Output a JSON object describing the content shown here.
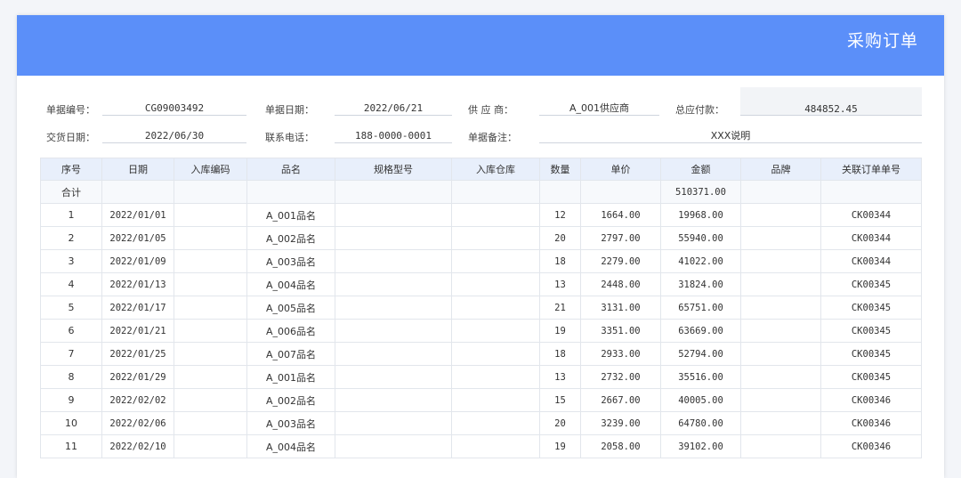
{
  "title": "采购订单",
  "info": {
    "order_no_label": "单据编号：",
    "order_no": "CG09003492",
    "order_date_label": "单据日期：",
    "order_date": "2022/06/21",
    "supplier_label": "供 应 商：",
    "supplier": "A_001供应商",
    "total_payable_label": "总应付款：",
    "total_payable": "484852.45",
    "delivery_date_label": "交货日期：",
    "delivery_date": "2022/06/30",
    "phone_label": "联系电话：",
    "phone": "188-0000-0001",
    "remark_label": "单据备注：",
    "remark": "XXX说明"
  },
  "table": {
    "headers": [
      "序号",
      "日期",
      "入库编码",
      "品名",
      "规格型号",
      "入库仓库",
      "数量",
      "单价",
      "金额",
      "品牌",
      "关联订单单号"
    ],
    "total_row": [
      "合计",
      "",
      "",
      "",
      "",
      "",
      "",
      "",
      "510371.00",
      "",
      ""
    ],
    "rows": [
      [
        "1",
        "2022/01/01",
        "",
        "A_001品名",
        "",
        "",
        "12",
        "1664.00",
        "19968.00",
        "",
        "CK00344"
      ],
      [
        "2",
        "2022/01/05",
        "",
        "A_002品名",
        "",
        "",
        "20",
        "2797.00",
        "55940.00",
        "",
        "CK00344"
      ],
      [
        "3",
        "2022/01/09",
        "",
        "A_003品名",
        "",
        "",
        "18",
        "2279.00",
        "41022.00",
        "",
        "CK00344"
      ],
      [
        "4",
        "2022/01/13",
        "",
        "A_004品名",
        "",
        "",
        "13",
        "2448.00",
        "31824.00",
        "",
        "CK00345"
      ],
      [
        "5",
        "2022/01/17",
        "",
        "A_005品名",
        "",
        "",
        "21",
        "3131.00",
        "65751.00",
        "",
        "CK00345"
      ],
      [
        "6",
        "2022/01/21",
        "",
        "A_006品名",
        "",
        "",
        "19",
        "3351.00",
        "63669.00",
        "",
        "CK00345"
      ],
      [
        "7",
        "2022/01/25",
        "",
        "A_007品名",
        "",
        "",
        "18",
        "2933.00",
        "52794.00",
        "",
        "CK00345"
      ],
      [
        "8",
        "2022/01/29",
        "",
        "A_001品名",
        "",
        "",
        "13",
        "2732.00",
        "35516.00",
        "",
        "CK00345"
      ],
      [
        "9",
        "2022/02/02",
        "",
        "A_002品名",
        "",
        "",
        "15",
        "2667.00",
        "40005.00",
        "",
        "CK00346"
      ],
      [
        "10",
        "2022/02/06",
        "",
        "A_003品名",
        "",
        "",
        "20",
        "3239.00",
        "64780.00",
        "",
        "CK00346"
      ],
      [
        "11",
        "2022/02/10",
        "",
        "A_004品名",
        "",
        "",
        "19",
        "2058.00",
        "39102.00",
        "",
        "CK00346"
      ]
    ]
  },
  "colors": {
    "banner": "#5b8ff9",
    "header_bg": "#e8effb"
  }
}
